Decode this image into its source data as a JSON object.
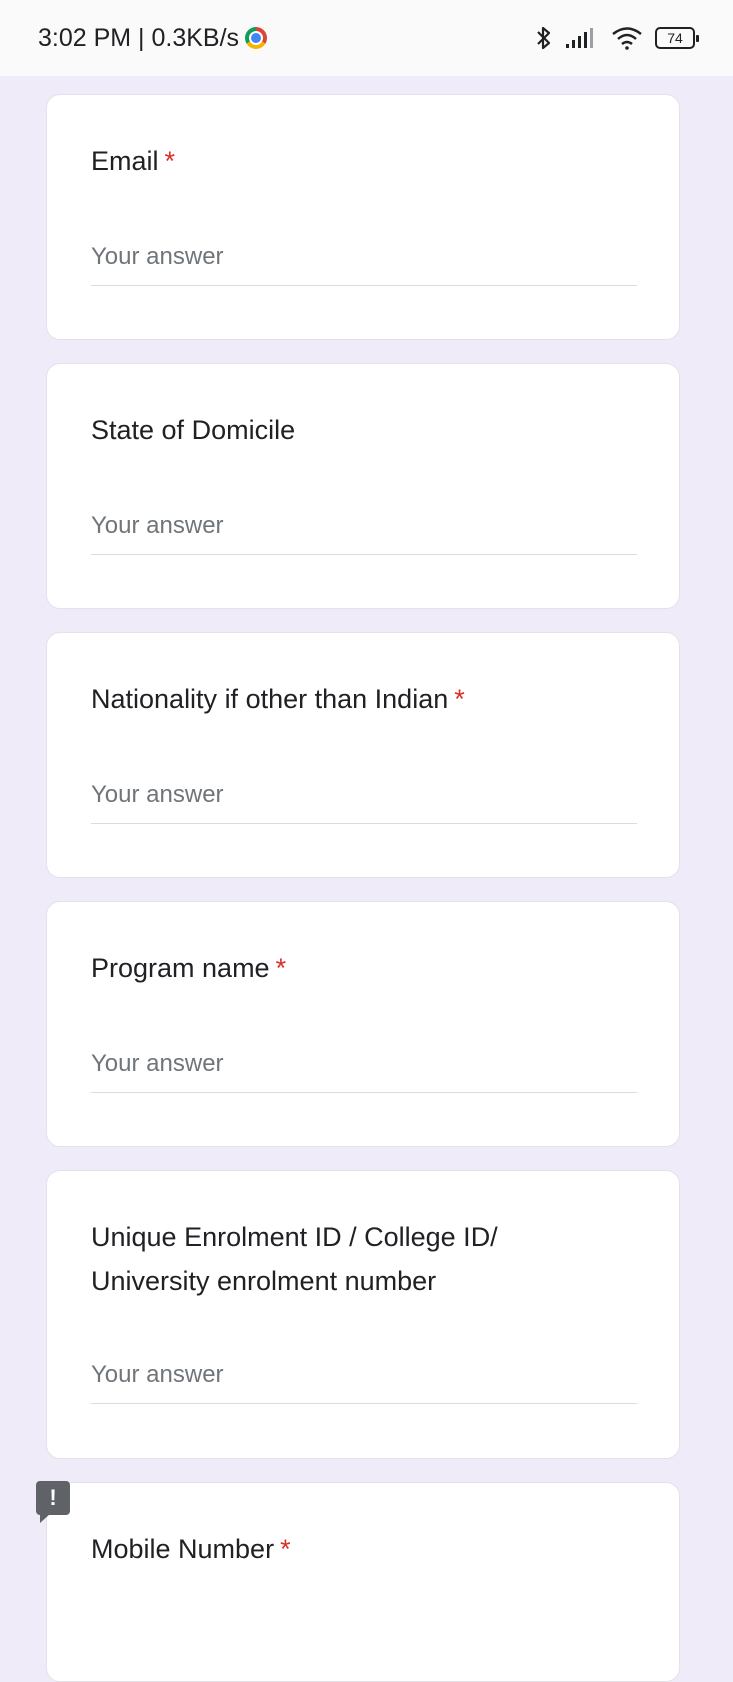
{
  "status_bar": {
    "time_speed": "3:02 PM | 0.3KB/s",
    "battery": "74",
    "icons": [
      "chrome-icon",
      "bluetooth-icon",
      "signal-icon",
      "wifi-icon",
      "battery-icon"
    ]
  },
  "questions": [
    {
      "title": "Email",
      "required": "*",
      "placeholder": "Your answer"
    },
    {
      "title": "State of Domicile",
      "required": "",
      "placeholder": "Your answer"
    },
    {
      "title": "Nationality if other than Indian",
      "required": "*",
      "placeholder": "Your answer"
    },
    {
      "title": "Program name",
      "required": "*",
      "placeholder": "Your answer"
    },
    {
      "title_line1": "Unique Enrolment ID / College ID/",
      "title_line2": "University enrolment number",
      "required": "",
      "placeholder": "Your answer"
    },
    {
      "title": "Mobile Number",
      "required": "*"
    }
  ],
  "colors": {
    "background": "#f0ebf8",
    "required": "#d93025",
    "card": "#ffffff"
  }
}
